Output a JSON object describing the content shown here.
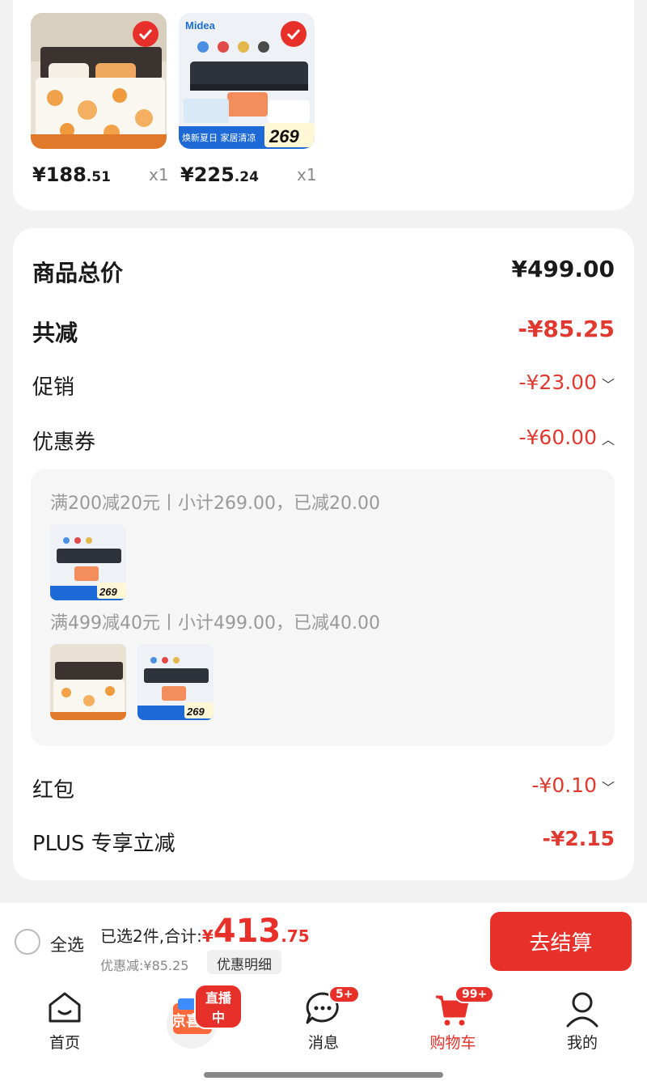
{
  "products": [
    {
      "name": "bedding-set",
      "price_int": "¥188",
      "price_dec": ".51",
      "qty": "x1",
      "selected": true
    },
    {
      "name": "vacuum-sealer",
      "price_int": "¥225",
      "price_dec": ".24",
      "qty": "x1",
      "selected": true,
      "brand": "Midea",
      "promo_price": "269",
      "promo_tag": "焕新夏日 家居清凉"
    }
  ],
  "summary": {
    "total_label": "商品总价",
    "total_value": "¥499.00",
    "discount_label": "共减",
    "discount_value": "-¥85.25",
    "promo_label": "促销",
    "promo_value": "-¥23.00",
    "coupon_label": "优惠券",
    "coupon_value": "-¥60.00",
    "redpacket_label": "红包",
    "redpacket_value": "-¥0.10",
    "plus_label": "PLUS 专享立减",
    "plus_value": "-¥2.15"
  },
  "coupons": [
    {
      "text": "满200减20元丨小计269.00，已减20.00"
    },
    {
      "text": "满499减40元丨小计499.00，已减40.00"
    }
  ],
  "bottom": {
    "select_all": "全选",
    "selected_text": "已选2件,合计:",
    "currency": "¥",
    "total_int": "413",
    "total_dec": ".75",
    "discount_text": "优惠减:¥85.25",
    "detail_button": "优惠明细",
    "checkout_button": "去结算"
  },
  "tabs": [
    {
      "label": "首页"
    },
    {
      "label": "京喜",
      "badge": "直播中"
    },
    {
      "label": "消息",
      "badge": "5+"
    },
    {
      "label": "购物车",
      "badge": "99+",
      "active": true
    },
    {
      "label": "我的"
    }
  ],
  "colors": {
    "accent": "#e8302a",
    "discount": "#e0392f"
  }
}
